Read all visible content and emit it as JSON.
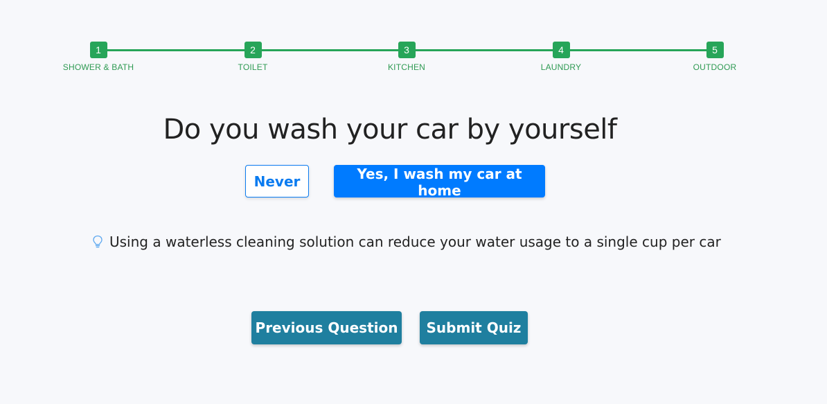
{
  "stepper": {
    "steps": [
      {
        "number": "1",
        "label": "SHOWER & BATH"
      },
      {
        "number": "2",
        "label": "TOILET"
      },
      {
        "number": "3",
        "label": "KITCHEN"
      },
      {
        "number": "4",
        "label": "LAUNDRY"
      },
      {
        "number": "5",
        "label": "OUTDOOR"
      }
    ],
    "color": "#27a559"
  },
  "question": {
    "text": "Do you wash your car by yourself"
  },
  "answers": {
    "never_label": "Never",
    "yes_label": "Yes, I wash my car at home"
  },
  "tip": {
    "icon": "lightbulb-icon",
    "text": "Using a waterless cleaning solution can reduce your water usage to a single cup per car"
  },
  "nav": {
    "previous_label": "Previous Question",
    "submit_label": "Submit Quiz"
  },
  "colors": {
    "primary": "#007bff",
    "nav": "#1f7f9f",
    "success": "#27a559",
    "background": "#f7f8fb"
  }
}
